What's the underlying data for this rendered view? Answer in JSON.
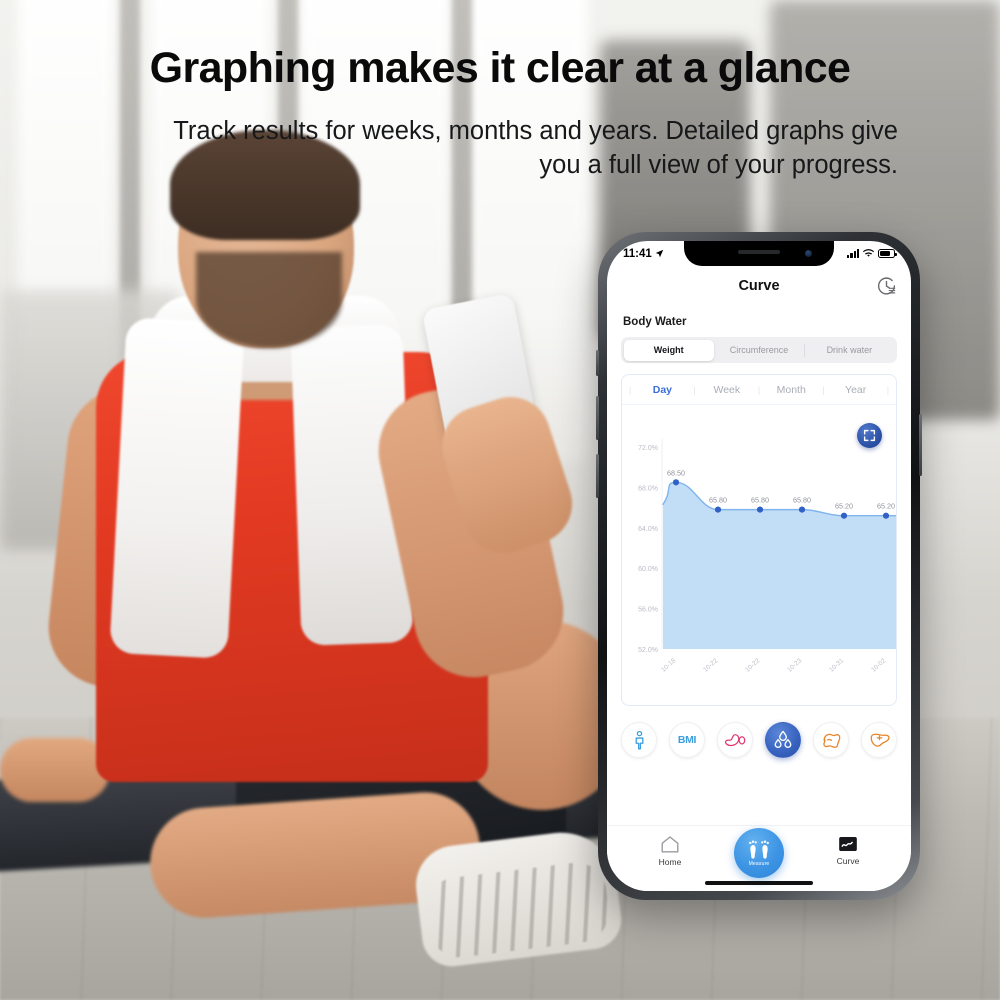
{
  "promo": {
    "headline": "Graphing makes it clear at a glance",
    "subhead": "Track results for weeks, months and years. Detailed graphs give you a full view of your progress."
  },
  "phone": {
    "status_bar": {
      "time": "11:41",
      "location_icon": "location-arrow-icon",
      "cellular_icon": "cellular-signal-icon",
      "wifi_icon": "wifi-icon",
      "battery_icon": "battery-icon"
    },
    "nav": {
      "title": "Curve",
      "history_icon": "history-clock-icon"
    },
    "section_title": "Body Water",
    "segmented": {
      "options": [
        {
          "label": "Weight",
          "active": true
        },
        {
          "label": "Circumference",
          "active": false
        },
        {
          "label": "Drink water",
          "active": false
        }
      ]
    },
    "range_tabs": [
      {
        "label": "Day",
        "active": true
      },
      {
        "label": "Week",
        "active": false
      },
      {
        "label": "Month",
        "active": false
      },
      {
        "label": "Year",
        "active": false
      }
    ],
    "expand_button": {
      "icon": "fullscreen-expand-icon"
    },
    "metrics": [
      {
        "name": "body-figure",
        "label": "",
        "selected": false,
        "color": "#3a9ee0"
      },
      {
        "name": "bmi",
        "label": "BMI",
        "selected": false,
        "color": "#3a9ee0"
      },
      {
        "name": "body-fat",
        "label": "",
        "selected": false,
        "color": "#e0356e"
      },
      {
        "name": "body-water",
        "label": "",
        "selected": true,
        "color": "#ffffff"
      },
      {
        "name": "muscle",
        "label": "",
        "selected": false,
        "color": "#e8842a"
      },
      {
        "name": "visceral-fat",
        "label": "",
        "selected": false,
        "color": "#e8842a"
      }
    ],
    "tabbar": {
      "home": {
        "label": "Home",
        "icon": "home-icon",
        "active": false
      },
      "measure": {
        "label": "Measure",
        "icon": "footprints-icon"
      },
      "curve": {
        "label": "Curve",
        "icon": "chart-line-icon",
        "active": true
      }
    }
  },
  "chart_data": {
    "type": "area",
    "title": "Body Water",
    "xlabel": "",
    "ylabel": "",
    "unit": "%",
    "x": [
      "10-18",
      "10-22",
      "10-22",
      "10-23",
      "10-31",
      "10-02"
    ],
    "values": [
      68.5,
      65.8,
      65.8,
      65.8,
      65.2,
      65.2
    ],
    "point_labels": [
      "68.50",
      "65.80",
      "65.80",
      "65.80",
      "65.20",
      "65.20"
    ],
    "ylim": [
      52.0,
      72.0
    ],
    "yticks": [
      "72.0%",
      "68.0%",
      "64.0%",
      "60.0%",
      "56.0%",
      "52.0%"
    ],
    "ytick_values": [
      72.0,
      68.0,
      64.0,
      60.0,
      56.0,
      52.0
    ],
    "grid": false,
    "legend": "none",
    "line_color": "#2f62c4",
    "fill_color": "#bfdcf7",
    "point_color": "#2f62c4"
  }
}
